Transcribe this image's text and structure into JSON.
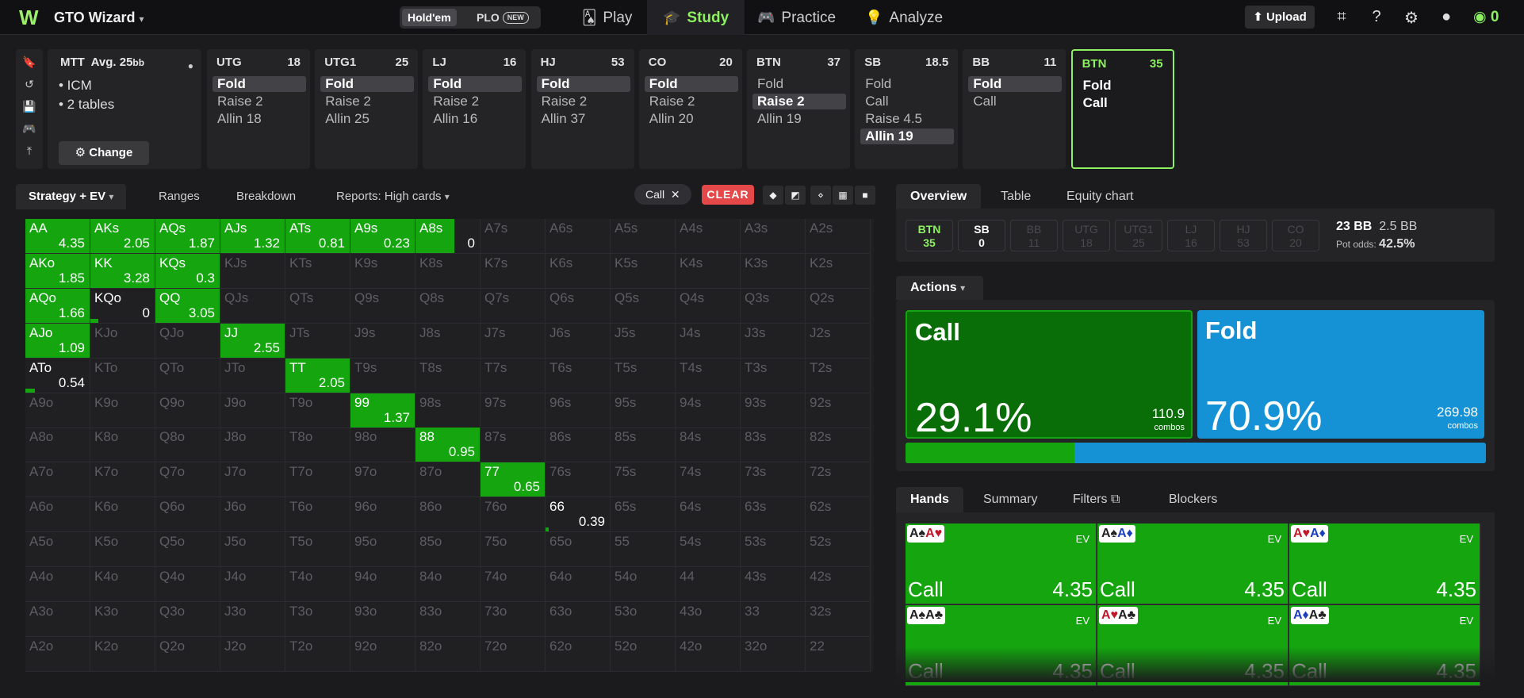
{
  "app": {
    "title": "GTO Wizard",
    "balance": "0"
  },
  "game_toggle": {
    "holdem": "Hold'em",
    "plo": "PLO",
    "plo_badge": "NEW"
  },
  "nav": [
    {
      "label": "Play",
      "icon": "cards-icon"
    },
    {
      "label": "Study",
      "icon": "graduation-cap-icon",
      "active": true
    },
    {
      "label": "Practice",
      "icon": "gamepad-icon"
    },
    {
      "label": "Analyze",
      "icon": "bulb-icon"
    }
  ],
  "top_actions": {
    "upload": "Upload"
  },
  "mtt": {
    "title": "MTT",
    "avg": "Avg. 25",
    "avg_unit": "bb",
    "lines": [
      "• ICM",
      "• 2 tables"
    ],
    "change": "Change"
  },
  "nodes": [
    {
      "pos": "UTG",
      "stack": "18",
      "actions": [
        {
          "label": "Fold",
          "sel": true
        },
        {
          "label": "Raise 2"
        },
        {
          "label": "Allin 18"
        }
      ]
    },
    {
      "pos": "UTG1",
      "stack": "25",
      "actions": [
        {
          "label": "Fold",
          "sel": true
        },
        {
          "label": "Raise 2"
        },
        {
          "label": "Allin 25"
        }
      ]
    },
    {
      "pos": "LJ",
      "stack": "16",
      "actions": [
        {
          "label": "Fold",
          "sel": true
        },
        {
          "label": "Raise 2"
        },
        {
          "label": "Allin 16"
        }
      ]
    },
    {
      "pos": "HJ",
      "stack": "53",
      "actions": [
        {
          "label": "Fold",
          "sel": true
        },
        {
          "label": "Raise 2"
        },
        {
          "label": "Allin 37"
        }
      ]
    },
    {
      "pos": "CO",
      "stack": "20",
      "actions": [
        {
          "label": "Fold",
          "sel": true
        },
        {
          "label": "Raise 2"
        },
        {
          "label": "Allin 20"
        }
      ]
    },
    {
      "pos": "BTN",
      "stack": "37",
      "actions": [
        {
          "label": "Fold"
        },
        {
          "label": "Raise 2",
          "sel": true
        },
        {
          "label": "Allin 19"
        }
      ]
    },
    {
      "pos": "SB",
      "stack": "18.5",
      "actions": [
        {
          "label": "Fold"
        },
        {
          "label": "Call"
        },
        {
          "label": "Raise 4.5"
        },
        {
          "label": "Allin 19",
          "sel": true
        }
      ]
    },
    {
      "pos": "BB",
      "stack": "11",
      "actions": [
        {
          "label": "Fold",
          "sel": true
        },
        {
          "label": "Call"
        }
      ]
    },
    {
      "pos": "BTN",
      "stack": "35",
      "active": true,
      "actions": [
        {
          "label": "Fold"
        },
        {
          "label": "Call"
        }
      ]
    }
  ],
  "left_tabs": {
    "strategy": "Strategy + EV",
    "ranges": "Ranges",
    "breakdown": "Breakdown",
    "reports": "Reports: High cards"
  },
  "filter_chip": "Call",
  "clear": "CLEAR",
  "grid": {
    "rows": [
      [
        [
          "AA",
          1.0,
          "4.35"
        ],
        [
          "AKs",
          1.0,
          "2.05"
        ],
        [
          "AQs",
          1.0,
          "1.87"
        ],
        [
          "AJs",
          1.0,
          "1.32"
        ],
        [
          "ATs",
          1.0,
          "0.81"
        ],
        [
          "A9s",
          1.0,
          "0.23"
        ],
        [
          "A8s",
          0.6,
          "0"
        ],
        [
          "A7s",
          0,
          ""
        ],
        [
          "A6s",
          0,
          ""
        ],
        [
          "A5s",
          0,
          ""
        ],
        [
          "A4s",
          0,
          ""
        ],
        [
          "A3s",
          0,
          ""
        ],
        [
          "A2s",
          0,
          ""
        ]
      ],
      [
        [
          "AKo",
          1.0,
          "1.85"
        ],
        [
          "KK",
          1.0,
          "3.28"
        ],
        [
          "KQs",
          1.0,
          "0.3"
        ],
        [
          "KJs",
          0,
          ""
        ],
        [
          "KTs",
          0,
          ""
        ],
        [
          "K9s",
          0,
          ""
        ],
        [
          "K8s",
          0,
          ""
        ],
        [
          "K7s",
          0,
          ""
        ],
        [
          "K6s",
          0,
          ""
        ],
        [
          "K5s",
          0,
          ""
        ],
        [
          "K4s",
          0,
          ""
        ],
        [
          "K3s",
          0,
          ""
        ],
        [
          "K2s",
          0,
          ""
        ]
      ],
      [
        [
          "AQo",
          1.0,
          "1.66"
        ],
        [
          "KQo",
          0.12,
          "0"
        ],
        [
          "QQ",
          1.0,
          "3.05"
        ],
        [
          "QJs",
          0,
          ""
        ],
        [
          "QTs",
          0,
          ""
        ],
        [
          "Q9s",
          0,
          ""
        ],
        [
          "Q8s",
          0,
          ""
        ],
        [
          "Q7s",
          0,
          ""
        ],
        [
          "Q6s",
          0,
          ""
        ],
        [
          "Q5s",
          0,
          ""
        ],
        [
          "Q4s",
          0,
          ""
        ],
        [
          "Q3s",
          0,
          ""
        ],
        [
          "Q2s",
          0,
          ""
        ]
      ],
      [
        [
          "AJo",
          1.0,
          "1.09"
        ],
        [
          "KJo",
          0,
          ""
        ],
        [
          "QJo",
          0,
          ""
        ],
        [
          "JJ",
          1.0,
          "2.55"
        ],
        [
          "JTs",
          0,
          ""
        ],
        [
          "J9s",
          0,
          ""
        ],
        [
          "J8s",
          0,
          ""
        ],
        [
          "J7s",
          0,
          ""
        ],
        [
          "J6s",
          0,
          ""
        ],
        [
          "J5s",
          0,
          ""
        ],
        [
          "J4s",
          0,
          ""
        ],
        [
          "J3s",
          0,
          ""
        ],
        [
          "J2s",
          0,
          ""
        ]
      ],
      [
        [
          "ATo",
          0.15,
          "0.54"
        ],
        [
          "KTo",
          0,
          ""
        ],
        [
          "QTo",
          0,
          ""
        ],
        [
          "JTo",
          0,
          ""
        ],
        [
          "TT",
          1.0,
          "2.05"
        ],
        [
          "T9s",
          0,
          ""
        ],
        [
          "T8s",
          0,
          ""
        ],
        [
          "T7s",
          0,
          ""
        ],
        [
          "T6s",
          0,
          ""
        ],
        [
          "T5s",
          0,
          ""
        ],
        [
          "T4s",
          0,
          ""
        ],
        [
          "T3s",
          0,
          ""
        ],
        [
          "T2s",
          0,
          ""
        ]
      ],
      [
        [
          "A9o",
          0,
          ""
        ],
        [
          "K9o",
          0,
          ""
        ],
        [
          "Q9o",
          0,
          ""
        ],
        [
          "J9o",
          0,
          ""
        ],
        [
          "T9o",
          0,
          ""
        ],
        [
          "99",
          1.0,
          "1.37"
        ],
        [
          "98s",
          0,
          ""
        ],
        [
          "97s",
          0,
          ""
        ],
        [
          "96s",
          0,
          ""
        ],
        [
          "95s",
          0,
          ""
        ],
        [
          "94s",
          0,
          ""
        ],
        [
          "93s",
          0,
          ""
        ],
        [
          "92s",
          0,
          ""
        ]
      ],
      [
        [
          "A8o",
          0,
          ""
        ],
        [
          "K8o",
          0,
          ""
        ],
        [
          "Q8o",
          0,
          ""
        ],
        [
          "J8o",
          0,
          ""
        ],
        [
          "T8o",
          0,
          ""
        ],
        [
          "98o",
          0,
          ""
        ],
        [
          "88",
          1.0,
          "0.95"
        ],
        [
          "87s",
          0,
          ""
        ],
        [
          "86s",
          0,
          ""
        ],
        [
          "85s",
          0,
          ""
        ],
        [
          "84s",
          0,
          ""
        ],
        [
          "83s",
          0,
          ""
        ],
        [
          "82s",
          0,
          ""
        ]
      ],
      [
        [
          "A7o",
          0,
          ""
        ],
        [
          "K7o",
          0,
          ""
        ],
        [
          "Q7o",
          0,
          ""
        ],
        [
          "J7o",
          0,
          ""
        ],
        [
          "T7o",
          0,
          ""
        ],
        [
          "97o",
          0,
          ""
        ],
        [
          "87o",
          0,
          ""
        ],
        [
          "77",
          1.0,
          "0.65"
        ],
        [
          "76s",
          0,
          ""
        ],
        [
          "75s",
          0,
          ""
        ],
        [
          "74s",
          0,
          ""
        ],
        [
          "73s",
          0,
          ""
        ],
        [
          "72s",
          0,
          ""
        ]
      ],
      [
        [
          "A6o",
          0,
          ""
        ],
        [
          "K6o",
          0,
          ""
        ],
        [
          "Q6o",
          0,
          ""
        ],
        [
          "J6o",
          0,
          ""
        ],
        [
          "T6o",
          0,
          ""
        ],
        [
          "96o",
          0,
          ""
        ],
        [
          "86o",
          0,
          ""
        ],
        [
          "76o",
          0,
          ""
        ],
        [
          "66",
          0.05,
          "0.39"
        ],
        [
          "65s",
          0,
          ""
        ],
        [
          "64s",
          0,
          ""
        ],
        [
          "63s",
          0,
          ""
        ],
        [
          "62s",
          0,
          ""
        ]
      ],
      [
        [
          "A5o",
          0,
          ""
        ],
        [
          "K5o",
          0,
          ""
        ],
        [
          "Q5o",
          0,
          ""
        ],
        [
          "J5o",
          0,
          ""
        ],
        [
          "T5o",
          0,
          ""
        ],
        [
          "95o",
          0,
          ""
        ],
        [
          "85o",
          0,
          ""
        ],
        [
          "75o",
          0,
          ""
        ],
        [
          "65o",
          0,
          ""
        ],
        [
          "55",
          0,
          ""
        ],
        [
          "54s",
          0,
          ""
        ],
        [
          "53s",
          0,
          ""
        ],
        [
          "52s",
          0,
          ""
        ]
      ],
      [
        [
          "A4o",
          0,
          ""
        ],
        [
          "K4o",
          0,
          ""
        ],
        [
          "Q4o",
          0,
          ""
        ],
        [
          "J4o",
          0,
          ""
        ],
        [
          "T4o",
          0,
          ""
        ],
        [
          "94o",
          0,
          ""
        ],
        [
          "84o",
          0,
          ""
        ],
        [
          "74o",
          0,
          ""
        ],
        [
          "64o",
          0,
          ""
        ],
        [
          "54o",
          0,
          ""
        ],
        [
          "44",
          0,
          ""
        ],
        [
          "43s",
          0,
          ""
        ],
        [
          "42s",
          0,
          ""
        ]
      ],
      [
        [
          "A3o",
          0,
          ""
        ],
        [
          "K3o",
          0,
          ""
        ],
        [
          "Q3o",
          0,
          ""
        ],
        [
          "J3o",
          0,
          ""
        ],
        [
          "T3o",
          0,
          ""
        ],
        [
          "93o",
          0,
          ""
        ],
        [
          "83o",
          0,
          ""
        ],
        [
          "73o",
          0,
          ""
        ],
        [
          "63o",
          0,
          ""
        ],
        [
          "53o",
          0,
          ""
        ],
        [
          "43o",
          0,
          ""
        ],
        [
          "33",
          0,
          ""
        ],
        [
          "32s",
          0,
          ""
        ]
      ],
      [
        [
          "A2o",
          0,
          ""
        ],
        [
          "K2o",
          0,
          ""
        ],
        [
          "Q2o",
          0,
          ""
        ],
        [
          "J2o",
          0,
          ""
        ],
        [
          "T2o",
          0,
          ""
        ],
        [
          "92o",
          0,
          ""
        ],
        [
          "82o",
          0,
          ""
        ],
        [
          "72o",
          0,
          ""
        ],
        [
          "62o",
          0,
          ""
        ],
        [
          "52o",
          0,
          ""
        ],
        [
          "42o",
          0,
          ""
        ],
        [
          "32o",
          0,
          ""
        ],
        [
          "22",
          0,
          ""
        ]
      ]
    ]
  },
  "right_tabs": {
    "overview": "Overview",
    "table": "Table",
    "equity": "Equity chart"
  },
  "seats": [
    {
      "pos": "BTN",
      "val": "35",
      "state": "btn"
    },
    {
      "pos": "SB",
      "val": "0",
      "state": "live"
    },
    {
      "pos": "BB",
      "val": "11",
      "state": "dead"
    },
    {
      "pos": "UTG",
      "val": "18",
      "state": "dead"
    },
    {
      "pos": "UTG1",
      "val": "25",
      "state": "dead"
    },
    {
      "pos": "LJ",
      "val": "16",
      "state": "dead"
    },
    {
      "pos": "HJ",
      "val": "53",
      "state": "dead"
    },
    {
      "pos": "CO",
      "val": "20",
      "state": "dead"
    }
  ],
  "pot": {
    "bb": "23 BB",
    "bet": "2.5 BB",
    "odds_label": "Pot odds:",
    "odds": "42.5%"
  },
  "actions_label": "Actions",
  "call": {
    "name": "Call",
    "pct": "29.1%",
    "combos": "110.9",
    "combos_label": "combos",
    "color": "#0a6e08",
    "freq": 0.291
  },
  "fold": {
    "name": "Fold",
    "pct": "70.9%",
    "combos": "269.98",
    "combos_label": "combos",
    "color": "#1592d6"
  },
  "hands_tabs": {
    "hands": "Hands",
    "summary": "Summary",
    "filters": "Filters",
    "blockers": "Blockers"
  },
  "hands": [
    {
      "cards": [
        [
          "A♠",
          "black"
        ],
        [
          "A♥",
          "red"
        ]
      ],
      "ev_label": "EV",
      "action": "Call",
      "ev": "4.35"
    },
    {
      "cards": [
        [
          "A♠",
          "black"
        ],
        [
          "A♦",
          "blue"
        ]
      ],
      "ev_label": "EV",
      "action": "Call",
      "ev": "4.35"
    },
    {
      "cards": [
        [
          "A♥",
          "red"
        ],
        [
          "A♦",
          "blue"
        ]
      ],
      "ev_label": "EV",
      "action": "Call",
      "ev": "4.35"
    },
    {
      "cards": [
        [
          "A♠",
          "black"
        ],
        [
          "A♣",
          "black"
        ]
      ],
      "ev_label": "EV",
      "action": "Call",
      "ev": "4.35"
    },
    {
      "cards": [
        [
          "A♥",
          "red"
        ],
        [
          "A♣",
          "black"
        ]
      ],
      "ev_label": "EV",
      "action": "Call",
      "ev": "4.35"
    },
    {
      "cards": [
        [
          "A♦",
          "blue"
        ],
        [
          "A♣",
          "black"
        ]
      ],
      "ev_label": "EV",
      "action": "Call",
      "ev": "4.35"
    }
  ]
}
